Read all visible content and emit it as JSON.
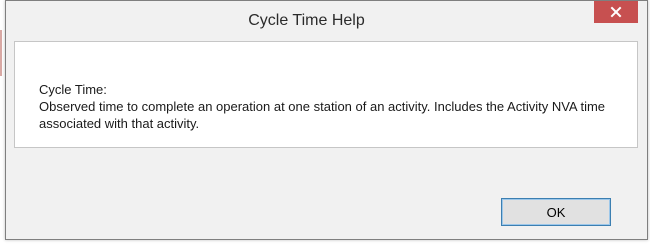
{
  "window": {
    "title": "Cycle Time Help",
    "close_icon": "close-icon"
  },
  "content": {
    "heading": "Cycle Time:",
    "body": "Observed time to complete an operation at one station of an activity. Includes the Activity NVA time associated with that activity."
  },
  "footer": {
    "ok_label": "OK"
  },
  "colors": {
    "close_button": "#c75050",
    "ok_border": "#3c7fb1"
  }
}
